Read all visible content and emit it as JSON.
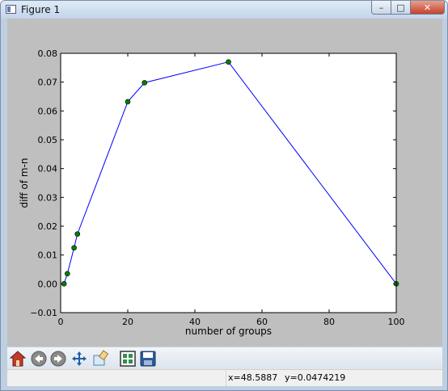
{
  "window": {
    "title": "Figure 1",
    "controls": {
      "minimize": "–",
      "maximize": "□",
      "close": "✕"
    }
  },
  "toolbar": {
    "buttons": [
      {
        "name": "home-icon",
        "icon": "home"
      },
      {
        "name": "back-icon",
        "icon": "arrow-left"
      },
      {
        "name": "forward-icon",
        "icon": "arrow-right"
      },
      {
        "name": "pan-icon",
        "icon": "move"
      },
      {
        "name": "zoom-icon",
        "icon": "zoom-rect"
      },
      {
        "name": "subplots-icon",
        "icon": "configure-subplots"
      },
      {
        "name": "save-icon",
        "icon": "floppy-disk"
      }
    ]
  },
  "status": {
    "x": "x=48.5887",
    "y": "y=0.0474219"
  },
  "chart_data": {
    "type": "line",
    "xlabel": "number of groups",
    "ylabel": "diff of m-n",
    "xlim": [
      0,
      100
    ],
    "ylim": [
      -0.01,
      0.08
    ],
    "xticks": [
      0,
      20,
      40,
      60,
      80,
      100
    ],
    "xtick_labels": [
      "0",
      "20",
      "40",
      "60",
      "80",
      "100"
    ],
    "yticks": [
      -0.01,
      0.0,
      0.01,
      0.02,
      0.03,
      0.04,
      0.05,
      0.06,
      0.07,
      0.08
    ],
    "ytick_labels": [
      "−0.01",
      "0.00",
      "0.01",
      "0.02",
      "0.03",
      "0.04",
      "0.05",
      "0.06",
      "0.07",
      "0.08"
    ],
    "x": [
      1,
      2,
      4,
      5,
      20,
      25,
      50,
      100
    ],
    "y": [
      0.0,
      0.0035,
      0.0125,
      0.0173,
      0.0632,
      0.0698,
      0.077,
      0.0
    ],
    "line_color": "#0000ff",
    "marker_color": "#007f00",
    "grid": false
  }
}
